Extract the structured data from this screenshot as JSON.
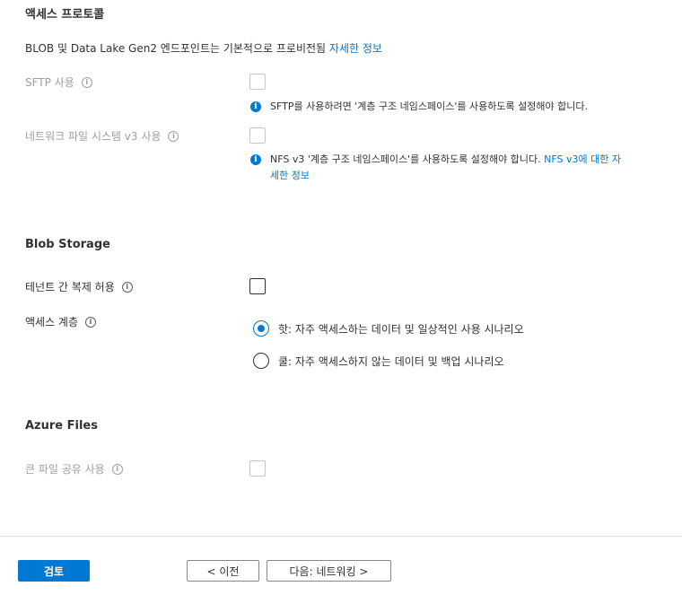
{
  "access_protocol": {
    "title": "액세스 프로토콜",
    "description": "BLOB 및 Data Lake Gen2 엔드포인트는 기본적으로 프로비전됨",
    "description_link": "자세한 정보",
    "sftp": {
      "label": "SFTP 사용",
      "checked": false,
      "disabled": true,
      "note": "SFTP를 사용하려면 '계층 구조 네임스페이스'를 사용하도록 설정해야 합니다."
    },
    "nfs": {
      "label": "네트워크 파일 시스템 v3 사용",
      "checked": false,
      "disabled": true,
      "note_line1": "NFS v3 '계층 구조 네임스페이스'를 사용하도록 설정해야 합니다.",
      "note_link_line1": "NFS v3에 대한 자",
      "note_link_line2": "세한 정보"
    }
  },
  "blob_storage": {
    "title": "Blob Storage",
    "cross_tenant": {
      "label": "테넌트 간 복제 허용",
      "checked": false
    },
    "access_tier": {
      "label": "액세스 계층",
      "options": [
        {
          "text": "핫: 자주 액세스하는 데이터 및 일상적인 사용 시나리오",
          "checked": true
        },
        {
          "text": "쿨: 자주 액세스하지 않는 데이터 및 백업 시나리오",
          "checked": false
        }
      ]
    }
  },
  "azure_files": {
    "title": "Azure Files",
    "large_share": {
      "label": "큰 파일 공유 사용",
      "checked": false,
      "disabled": true
    }
  },
  "footer": {
    "review_label": "검토",
    "previous_label": "< 이전",
    "next_label": "다음: 네트워킹 >"
  },
  "icons": {
    "info": "info-circle-icon",
    "note": "info-filled-icon"
  },
  "colors": {
    "accent": "#0078d4",
    "text": "#323130",
    "disabled_text": "#a19f9d",
    "divider": "#e1dfdd"
  }
}
